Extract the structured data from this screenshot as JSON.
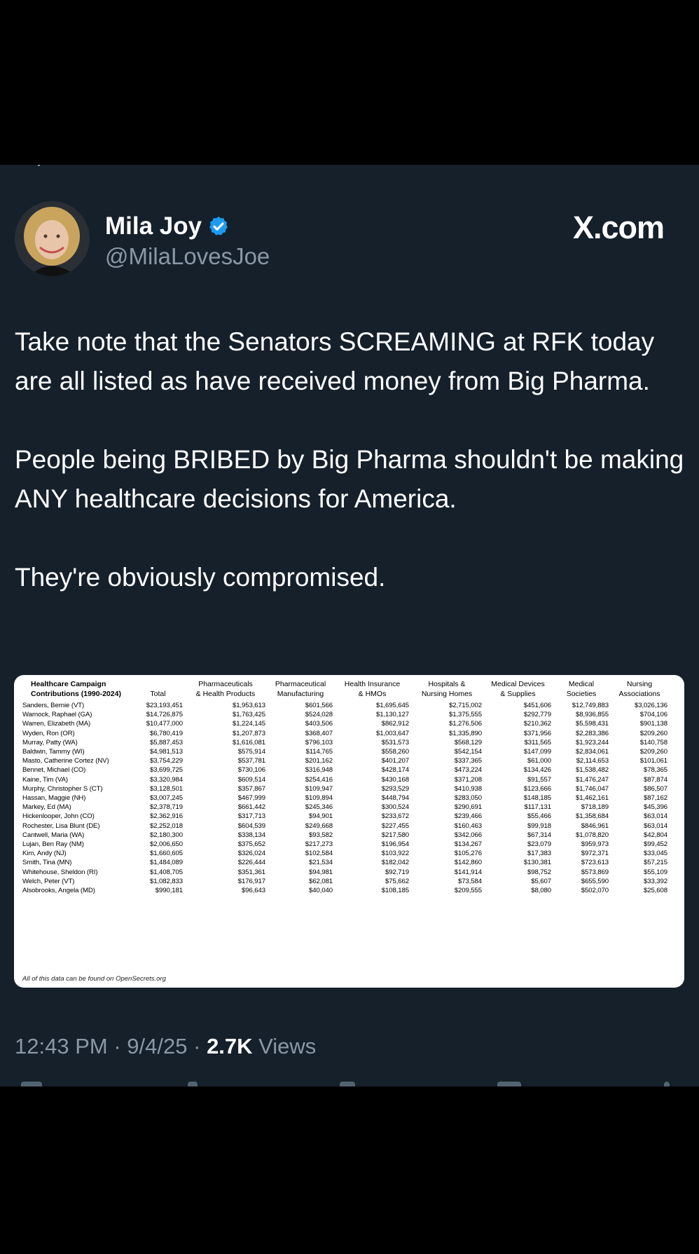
{
  "tweet": {
    "author_name": "Mila Joy",
    "author_handle": "@MilaLovesJoe",
    "verified": true,
    "source_logo": "X.com",
    "paragraphs": [
      "Take note that the Senators SCREAMING at RFK today are all listed as have received money from Big Pharma.",
      "People being BRIBED by Big Pharma shouldn't be making ANY healthcare decisions for America.",
      "They're obviously compromised."
    ],
    "time": "12:43 PM",
    "date": "9/4/25",
    "views_count": "2.7K",
    "views_label": "Views",
    "separator": "·"
  },
  "icons": {
    "verified_badge": "verified-check-icon",
    "accent": "#1d9bf0"
  },
  "table": {
    "headers": [
      [
        "Healthcare Campaign",
        "Contributions (1990-2024)"
      ],
      [
        "Total"
      ],
      [
        "Pharmaceuticals",
        "& Health Products"
      ],
      [
        "Pharmaceutical",
        "Manufacturing"
      ],
      [
        "Health Insurance",
        "& HMOs"
      ],
      [
        "Hospitals &",
        "Nursing Homes"
      ],
      [
        "Medical Devices",
        "& Supplies"
      ],
      [
        "Medical",
        "Societies"
      ],
      [
        "Nursing",
        "Associations"
      ]
    ],
    "rows": [
      [
        "Sanders, Bernie (VT)",
        "$23,193,451",
        "$1,953,613",
        "$601,566",
        "$1,695,645",
        "$2,715,002",
        "$451,606",
        "$12,749,883",
        "$3,026,136"
      ],
      [
        "Warnock, Raphael (GA)",
        "$14,726,875",
        "$1,763,425",
        "$524,028",
        "$1,130,127",
        "$1,375,555",
        "$292,779",
        "$8,936,855",
        "$704,106"
      ],
      [
        "Warren, Elizabeth (MA)",
        "$10,477,000",
        "$1,224,145",
        "$403,506",
        "$862,912",
        "$1,276,506",
        "$210,362",
        "$5,598,431",
        "$901,138"
      ],
      [
        "Wyden, Ron (OR)",
        "$6,780,419",
        "$1,207,873",
        "$368,407",
        "$1,003,647",
        "$1,335,890",
        "$371,956",
        "$2,283,386",
        "$209,260"
      ],
      [
        "Murray, Patty (WA)",
        "$5,887,453",
        "$1,616,081",
        "$796,103",
        "$531,573",
        "$568,129",
        "$311,565",
        "$1,923,244",
        "$140,758"
      ],
      [
        "Baldwin, Tammy (WI)",
        "$4,981,513",
        "$575,914",
        "$114,765",
        "$558,260",
        "$542,154",
        "$147,099",
        "$2,834,061",
        "$209,260"
      ],
      [
        "Masto, Catherine Cortez (NV)",
        "$3,754,229",
        "$537,781",
        "$201,162",
        "$401,207",
        "$337,365",
        "$61,000",
        "$2,114,653",
        "$101,061"
      ],
      [
        "Bennet, Michael (CO)",
        "$3,699,725",
        "$730,106",
        "$316,948",
        "$428,174",
        "$473,224",
        "$134,426",
        "$1,538,482",
        "$78,365"
      ],
      [
        "Kaine, Tim (VA)",
        "$3,320,984",
        "$609,514",
        "$254,416",
        "$430,168",
        "$371,208",
        "$91,557",
        "$1,476,247",
        "$87,874"
      ],
      [
        "Murphy, Christopher S (CT)",
        "$3,128,501",
        "$357,867",
        "$109,947",
        "$293,529",
        "$410,938",
        "$123,666",
        "$1,746,047",
        "$86,507"
      ],
      [
        "Hassan, Maggie (NH)",
        "$3,007,245",
        "$467,999",
        "$109,894",
        "$448,794",
        "$283,050",
        "$148,185",
        "$1,462,161",
        "$87,162"
      ],
      [
        "Markey, Ed (MA)",
        "$2,378,719",
        "$661,442",
        "$245,346",
        "$300,524",
        "$290,691",
        "$117,131",
        "$718,189",
        "$45,396"
      ],
      [
        "Hickenlooper, John (CO)",
        "$2,362,916",
        "$317,713",
        "$94,901",
        "$233,672",
        "$239,466",
        "$55,466",
        "$1,358,684",
        "$63,014"
      ],
      [
        "Rochester, Lisa Blunt (DE)",
        "$2,252,018",
        "$604,539",
        "$249,668",
        "$227,455",
        "$160,463",
        "$99,918",
        "$846,961",
        "$63,014"
      ],
      [
        "Cantwell, Maria (WA)",
        "$2,180,300",
        "$338,134",
        "$93,582",
        "$217,580",
        "$342,066",
        "$67,314",
        "$1,078,820",
        "$42,804"
      ],
      [
        "Lujan, Ben Ray (NM)",
        "$2,006,650",
        "$375,652",
        "$217,273",
        "$196,954",
        "$134,267",
        "$23,079",
        "$959,973",
        "$99,452"
      ],
      [
        "Kim, Andy (NJ)",
        "$1,660,605",
        "$326,024",
        "$102,584",
        "$103,922",
        "$105,276",
        "$17,383",
        "$972,371",
        "$33,045"
      ],
      [
        "Smith, Tina (MN)",
        "$1,484,089",
        "$226,444",
        "$21,534",
        "$182,042",
        "$142,860",
        "$130,381",
        "$723,613",
        "$57,215"
      ],
      [
        "Whitehouse, Sheldon (RI)",
        "$1,408,705",
        "$351,361",
        "$94,981",
        "$92,719",
        "$141,914",
        "$98,752",
        "$573,869",
        "$55,109"
      ],
      [
        "Welch, Peter (VT)",
        "$1,082,833",
        "$176,917",
        "$62,081",
        "$75,662",
        "$73,584",
        "$5,607",
        "$655,590",
        "$33,392"
      ],
      [
        "Alsobrooks, Angela (MD)",
        "$990,181",
        "$96,643",
        "$40,040",
        "$108,185",
        "$209,555",
        "$8,080",
        "$502,070",
        "$25,608"
      ]
    ],
    "footnote": "All of this data can be found on OpenSecrets.org"
  }
}
